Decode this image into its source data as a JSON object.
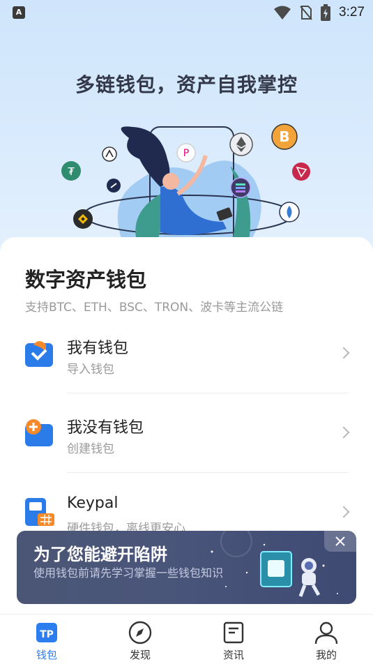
{
  "status_bar": {
    "notification_icon": "A",
    "time": "3:27",
    "icons": [
      "wifi-icon",
      "no-sim-icon",
      "battery-charging-icon"
    ]
  },
  "hero": {
    "title": "多链钱包，资产自我掌控"
  },
  "main": {
    "title": "数字资产钱包",
    "subtitle": "支持BTC、ETH、BSC、TRON、波卡等主流公链",
    "options": [
      {
        "title": "我有钱包",
        "subtitle": "导入钱包",
        "icon": "import-wallet-icon"
      },
      {
        "title": "我没有钱包",
        "subtitle": "创建钱包",
        "icon": "create-wallet-icon"
      },
      {
        "title": "Keypal",
        "subtitle": "硬件钱包，离线更安心",
        "icon": "hardware-wallet-icon"
      }
    ]
  },
  "banner": {
    "title": "为了您能避开陷阱",
    "text": "使用钱包前请先学习掌握一些钱包知识",
    "close_icon": "close-icon"
  },
  "tabbar": {
    "tabs": [
      {
        "label": "钱包",
        "icon": "wallet-tp-icon",
        "active": true
      },
      {
        "label": "发现",
        "icon": "compass-icon",
        "active": false
      },
      {
        "label": "资讯",
        "icon": "news-icon",
        "active": false
      },
      {
        "label": "我的",
        "icon": "profile-icon",
        "active": false
      }
    ]
  },
  "colors": {
    "accent": "#2c7ef0",
    "hero_bg": "#d4e8fc",
    "banner_bg": "#4a557a",
    "bitcoin": "#f2a33a",
    "tron": "#c7284b"
  }
}
